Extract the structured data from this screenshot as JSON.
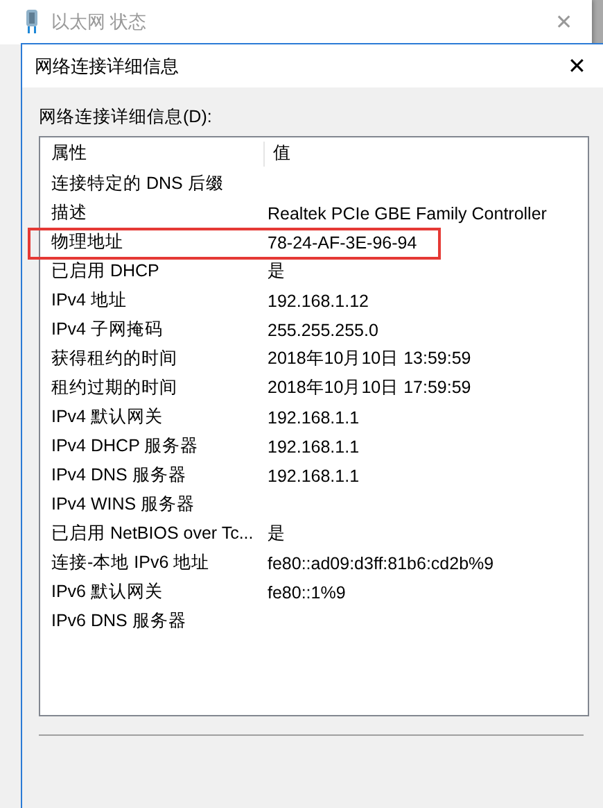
{
  "back_window": {
    "title": "以太网 状态",
    "close": "✕"
  },
  "dialog": {
    "title": "网络连接详细信息",
    "close": "✕",
    "list_label": "网络连接详细信息(D):",
    "columns": [
      "属性",
      "值"
    ],
    "rows": [
      {
        "property": "连接特定的 DNS 后缀",
        "value": "",
        "highlighted": false
      },
      {
        "property": "描述",
        "value": "Realtek PCIe GBE Family Controller",
        "highlighted": false
      },
      {
        "property": "物理地址",
        "value": "78-24-AF-3E-96-94",
        "highlighted": true
      },
      {
        "property": "已启用 DHCP",
        "value": "是",
        "highlighted": false
      },
      {
        "property": "IPv4 地址",
        "value": "192.168.1.12",
        "highlighted": false
      },
      {
        "property": "IPv4 子网掩码",
        "value": "255.255.255.0",
        "highlighted": false
      },
      {
        "property": "获得租约的时间",
        "value": "2018年10月10日 13:59:59",
        "highlighted": false
      },
      {
        "property": "租约过期的时间",
        "value": "2018年10月10日 17:59:59",
        "highlighted": false
      },
      {
        "property": "IPv4 默认网关",
        "value": "192.168.1.1",
        "highlighted": false
      },
      {
        "property": "IPv4 DHCP 服务器",
        "value": "192.168.1.1",
        "highlighted": false
      },
      {
        "property": "IPv4 DNS 服务器",
        "value": "192.168.1.1",
        "highlighted": false
      },
      {
        "property": "IPv4 WINS 服务器",
        "value": "",
        "highlighted": false
      },
      {
        "property": "已启用 NetBIOS over Tc...",
        "value": "是",
        "highlighted": false
      },
      {
        "property": "连接-本地 IPv6 地址",
        "value": "fe80::ad09:d3ff:81b6:cd2b%9",
        "highlighted": false
      },
      {
        "property": "IPv6 默认网关",
        "value": "fe80::1%9",
        "highlighted": false
      },
      {
        "property": "IPv6 DNS 服务器",
        "value": "",
        "highlighted": false
      }
    ]
  }
}
